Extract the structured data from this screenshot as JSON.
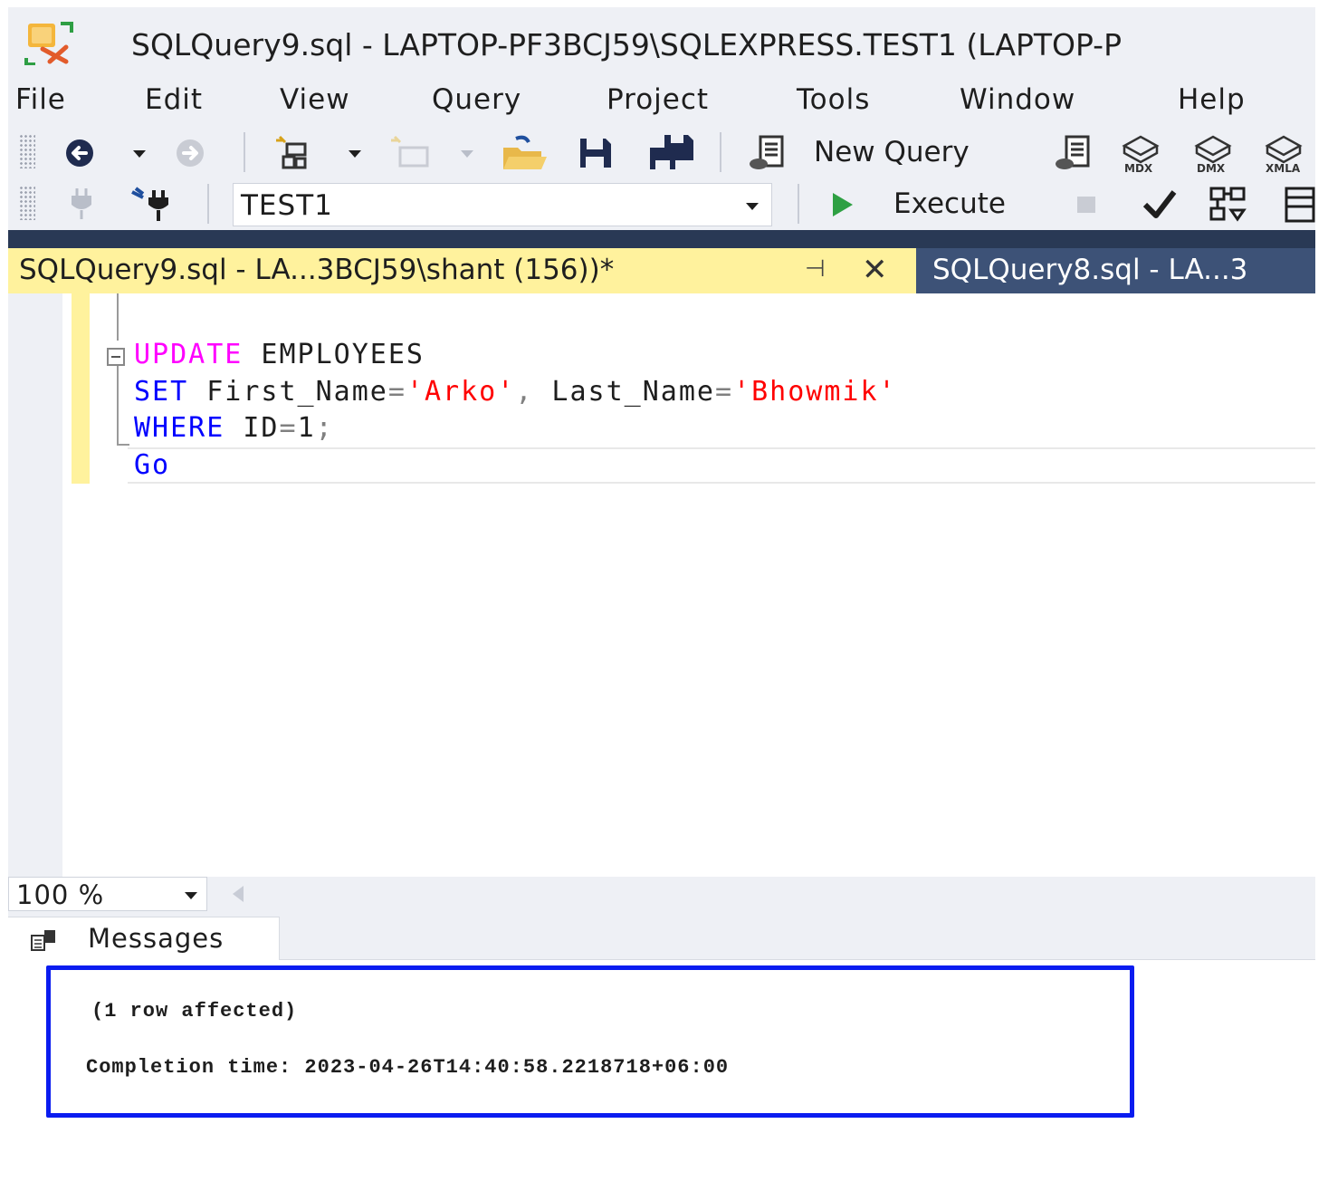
{
  "window": {
    "title": "SQLQuery9.sql - LAPTOP-PF3BCJ59\\SQLEXPRESS.TEST1 (LAPTOP-P"
  },
  "menu": [
    "File",
    "Edit",
    "View",
    "Query",
    "Project",
    "Tools",
    "Window",
    "Help"
  ],
  "toolbar1": {
    "new_query_label": "New Query",
    "icons": [
      "back-icon",
      "forward-icon",
      "new-project-icon",
      "add-item-icon",
      "open-file-icon",
      "save-icon",
      "save-all-icon",
      "new-query-icon",
      "database-engine-query-icon",
      "mdx-query-icon",
      "dmx-query-icon",
      "xmla-query-icon"
    ],
    "mdx_label": "MDX",
    "dmx_label": "DMX",
    "xmla_label": "XMLA"
  },
  "toolbar2": {
    "database": "TEST1",
    "execute_label": "Execute"
  },
  "tabs": {
    "active": "SQLQuery9.sql - LA...3BCJ59\\shant (156))*",
    "inactive": "SQLQuery8.sql - LA...3"
  },
  "editor": {
    "line1": {
      "kw": "UPDATE",
      "rest": " EMPLOYEES"
    },
    "line2": {
      "kw": "SET",
      "a": " First_Name",
      "eq1": "=",
      "s1": "'Arko'",
      "comma": ",",
      "b": " Last_Name",
      "eq2": "=",
      "s2": "'Bhowmik'"
    },
    "line3": {
      "kw": "WHERE",
      "a": " ID",
      "eq": "=",
      "n": "1",
      "semi": ";"
    },
    "line4": {
      "kw": "Go"
    }
  },
  "zoom": "100 %",
  "results": {
    "tab_label": "Messages",
    "line1": "(1 row affected)",
    "line2": "Completion time: 2023-04-26T14:40:58.2218718+06:00"
  },
  "colors": {
    "tab_active": "#fff29d",
    "highlight_box": "#0a1cf0",
    "keyword_pink": "#ff00ff",
    "keyword_blue": "#0000ff",
    "string_red": "#ff0000"
  }
}
